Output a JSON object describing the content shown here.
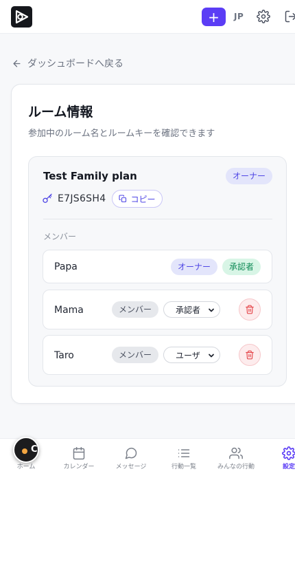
{
  "header": {
    "add_label": "+",
    "lang": "JP",
    "icons": {
      "logo": "app-logo",
      "settings": "gear-icon",
      "logout": "logout-icon"
    },
    "accent": "#5b3df5"
  },
  "back": {
    "label": "ダッシュボードへ戻る"
  },
  "card": {
    "title": "ルーム情報",
    "subtitle": "参加中のルーム名とルームキーを確認できます"
  },
  "room": {
    "name": "Test Family plan",
    "role_badge": "オーナー",
    "key": "E7JS6SH4",
    "copy_label": "コピー",
    "members_heading": "メンバー",
    "members": [
      {
        "name": "Papa",
        "badges": [
          "オーナー",
          "承認者"
        ]
      },
      {
        "name": "Mama",
        "badge": "メンバー",
        "role": "承認者"
      },
      {
        "name": "Taro",
        "badge": "メンバー",
        "role": "ユーザ"
      }
    ]
  },
  "nav": {
    "items": [
      {
        "label": "ホーム",
        "icon": "home-icon"
      },
      {
        "label": "カレンダー",
        "icon": "calendar-icon"
      },
      {
        "label": "メッセージ",
        "icon": "message-icon"
      },
      {
        "label": "行動一覧",
        "icon": "list-icon"
      },
      {
        "label": "みんなの行動",
        "icon": "users-icon"
      },
      {
        "label": "設定",
        "icon": "gear-icon",
        "active": true
      }
    ]
  },
  "floating_button": {
    "letter": "C"
  }
}
